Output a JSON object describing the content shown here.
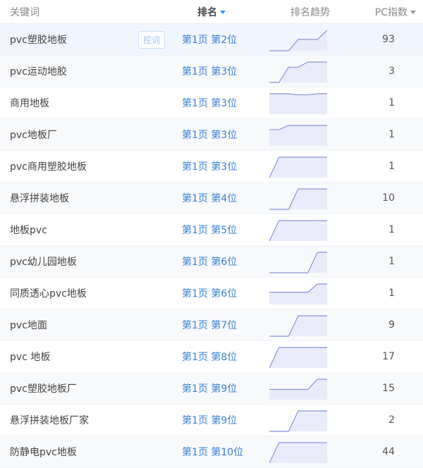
{
  "header": {
    "keyword": "关键词",
    "rank": "排名",
    "trend": "排名趋势",
    "pc_index": "PC指数"
  },
  "dig_button": "挖词",
  "colors": {
    "accent": "#3a7fd1",
    "spark_line": "#8b93d6",
    "spark_fill": "#e9ecf8"
  },
  "rows": [
    {
      "keyword": "pvc塑胶地板",
      "rank": "第1页 第2位",
      "pc": "93",
      "trend": [
        0.0,
        0.0,
        0.0,
        0.55,
        0.55,
        0.55,
        1.0
      ]
    },
    {
      "keyword": "pvc运动地胶",
      "rank": "第1页 第3位",
      "pc": "3",
      "trend": [
        0.0,
        0.0,
        0.75,
        0.75,
        1.0,
        1.0,
        1.0
      ]
    },
    {
      "keyword": "商用地板",
      "rank": "第1页 第3位",
      "pc": "1",
      "trend": [
        1.0,
        1.0,
        1.0,
        0.95,
        0.95,
        1.0,
        1.0
      ]
    },
    {
      "keyword": "pvc地板厂",
      "rank": "第1页 第3位",
      "pc": "1",
      "trend": [
        0.8,
        0.8,
        1.0,
        1.0,
        1.0,
        1.0,
        1.0
      ]
    },
    {
      "keyword": "pvc商用塑胶地板",
      "rank": "第1页 第3位",
      "pc": "1",
      "trend": [
        0.0,
        1.0,
        1.0,
        1.0,
        1.0,
        1.0,
        1.0
      ]
    },
    {
      "keyword": "悬浮拼装地板",
      "rank": "第1页 第4位",
      "pc": "10",
      "trend": [
        0.0,
        0.0,
        0.0,
        1.0,
        1.0,
        1.0,
        1.0
      ]
    },
    {
      "keyword": "地板pvc",
      "rank": "第1页 第5位",
      "pc": "1",
      "trend": [
        0.0,
        1.0,
        1.0,
        1.0,
        1.0,
        1.0,
        1.0
      ]
    },
    {
      "keyword": "pvc幼儿园地板",
      "rank": "第1页 第6位",
      "pc": "1",
      "trend": [
        0.0,
        0.0,
        0.0,
        0.0,
        0.0,
        1.0,
        1.0
      ]
    },
    {
      "keyword": "同质透心pvc地板",
      "rank": "第1页 第6位",
      "pc": "1",
      "trend": [
        0.6,
        0.6,
        0.6,
        0.6,
        0.6,
        1.0,
        1.0
      ]
    },
    {
      "keyword": "pvc地面",
      "rank": "第1页 第7位",
      "pc": "9",
      "trend": [
        0.0,
        0.0,
        0.0,
        1.0,
        1.0,
        1.0,
        1.0
      ]
    },
    {
      "keyword": "pvc 地板",
      "rank": "第1页 第8位",
      "pc": "17",
      "trend": [
        0.0,
        1.0,
        1.0,
        1.0,
        1.0,
        1.0,
        1.0
      ]
    },
    {
      "keyword": "pvc塑胶地板厂",
      "rank": "第1页 第9位",
      "pc": "15",
      "trend": [
        0.5,
        0.5,
        0.5,
        0.5,
        0.5,
        1.0,
        1.0
      ]
    },
    {
      "keyword": "悬浮拼装地板厂家",
      "rank": "第1页 第9位",
      "pc": "2",
      "trend": [
        0.0,
        0.0,
        0.0,
        1.0,
        1.0,
        1.0,
        1.0
      ]
    },
    {
      "keyword": "防静电pvc地板",
      "rank": "第1页 第10位",
      "pc": "44",
      "trend": [
        0.0,
        1.0,
        1.0,
        1.0,
        1.0,
        1.0,
        1.0
      ]
    }
  ]
}
